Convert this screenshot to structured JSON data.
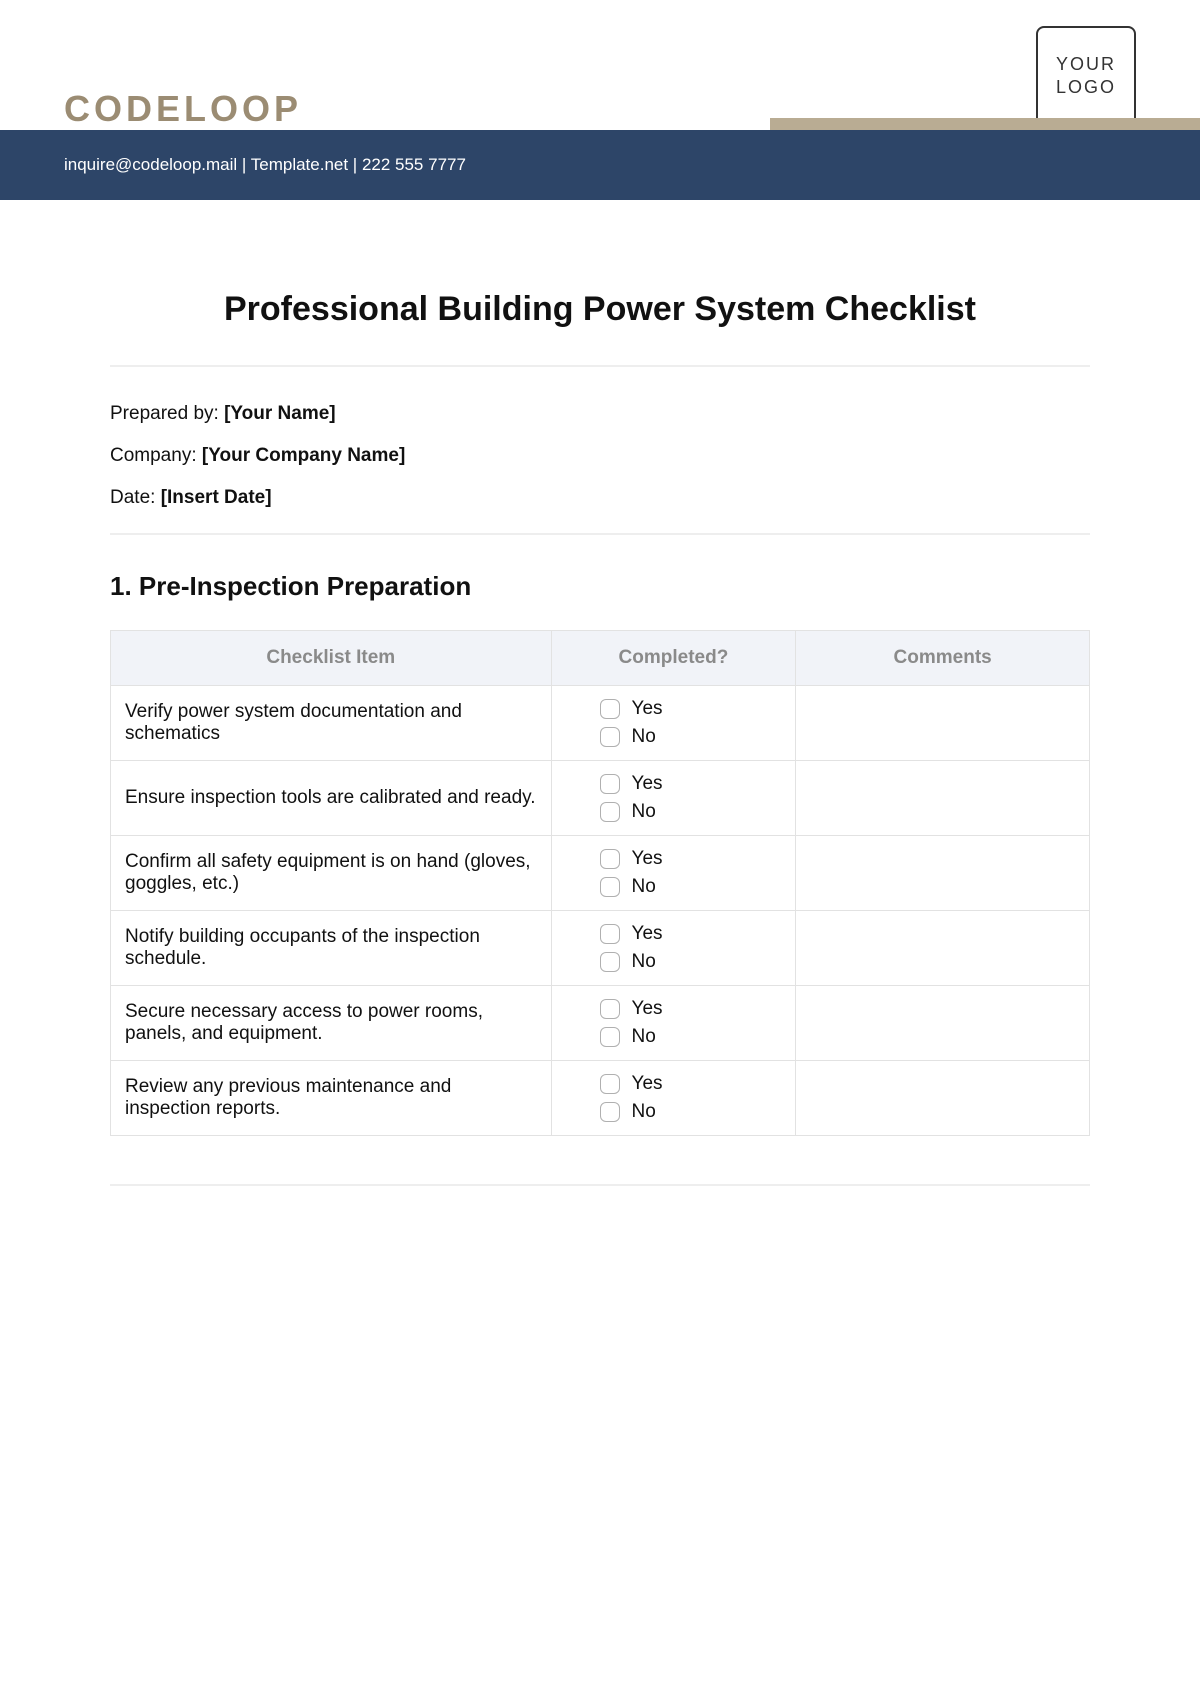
{
  "header": {
    "brand": "CODELOOP",
    "logo_text": "YOUR LOGO",
    "contact_line": "inquire@codeloop.mail | Template.net | 222 555 7777"
  },
  "document": {
    "title": "Professional Building Power System Checklist",
    "meta": {
      "prepared_by_label": "Prepared by:",
      "prepared_by_value": "[Your Name]",
      "company_label": "Company:",
      "company_value": "[Your Company Name]",
      "date_label": "Date:",
      "date_value": "[Insert Date]"
    }
  },
  "section1": {
    "heading": "1. Pre-Inspection Preparation",
    "columns": {
      "item": "Checklist Item",
      "completed": "Completed?",
      "comments": "Comments"
    },
    "yes": "Yes",
    "no": "No",
    "rows": [
      {
        "item": "Verify power system documentation and schematics",
        "comments": ""
      },
      {
        "item": "Ensure inspection tools are calibrated and ready.",
        "comments": ""
      },
      {
        "item": "Confirm all safety equipment is on hand (gloves, goggles, etc.)",
        "comments": ""
      },
      {
        "item": "Notify building occupants of the inspection schedule.",
        "comments": ""
      },
      {
        "item": "Secure necessary access to power rooms, panels, and equipment.",
        "comments": ""
      },
      {
        "item": "Review any previous maintenance and inspection reports.",
        "comments": ""
      }
    ]
  }
}
